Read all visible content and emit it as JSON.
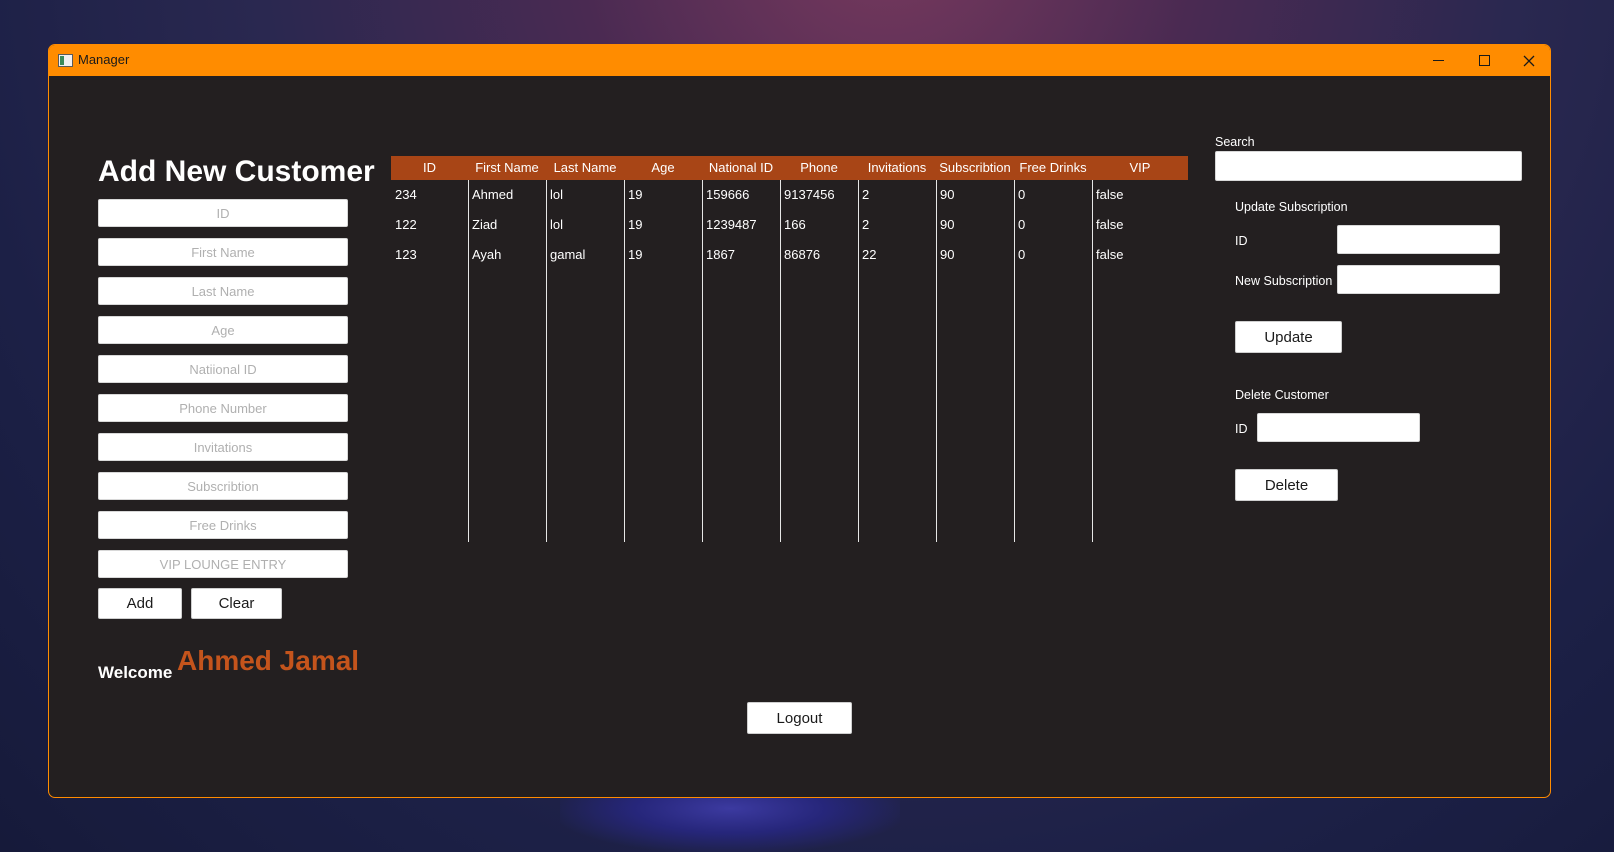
{
  "window": {
    "title": "Manager",
    "accent": "#ff8c00",
    "background": "#231f20"
  },
  "form": {
    "heading": "Add New Customer",
    "placeholders": {
      "id": "ID",
      "first_name": "First Name",
      "last_name": "Last Name",
      "age": "Age",
      "national_id": "Natiional ID",
      "phone": "Phone Number",
      "invitations": "Invitations",
      "subscription": "Subscribtion",
      "free_drinks": "Free Drinks",
      "vip": "VIP LOUNGE ENTRY"
    },
    "add_label": "Add",
    "clear_label": "Clear"
  },
  "welcome": {
    "label": "Welcome",
    "name": "Ahmed Jamal",
    "name_color": "#c4541c"
  },
  "table": {
    "header_color": "#a84516",
    "columns": [
      "ID",
      "First Name",
      "Last Name",
      "Age",
      "National ID",
      "Phone",
      "Invitations",
      "Subscribtion",
      "Free Drinks",
      "VIP"
    ],
    "rows": [
      [
        "234",
        "Ahmed",
        "lol",
        "19",
        "159666",
        "9137456",
        "2",
        "90",
        "0",
        "false"
      ],
      [
        "122",
        "Ziad",
        "lol",
        "19",
        "1239487",
        "166",
        "2",
        "90",
        "0",
        "false"
      ],
      [
        "123",
        "Ayah",
        "gamal",
        "19",
        "1867",
        "86876",
        "22",
        "90",
        "0",
        "false"
      ]
    ]
  },
  "search": {
    "label": "Search",
    "value": ""
  },
  "update_subscription": {
    "title": "Update Subscription",
    "id_label": "ID",
    "new_sub_label": "New Subscription",
    "button_label": "Update"
  },
  "delete_customer": {
    "title": "Delete Customer",
    "id_label": "ID",
    "button_label": "Delete"
  },
  "logout_label": "Logout"
}
